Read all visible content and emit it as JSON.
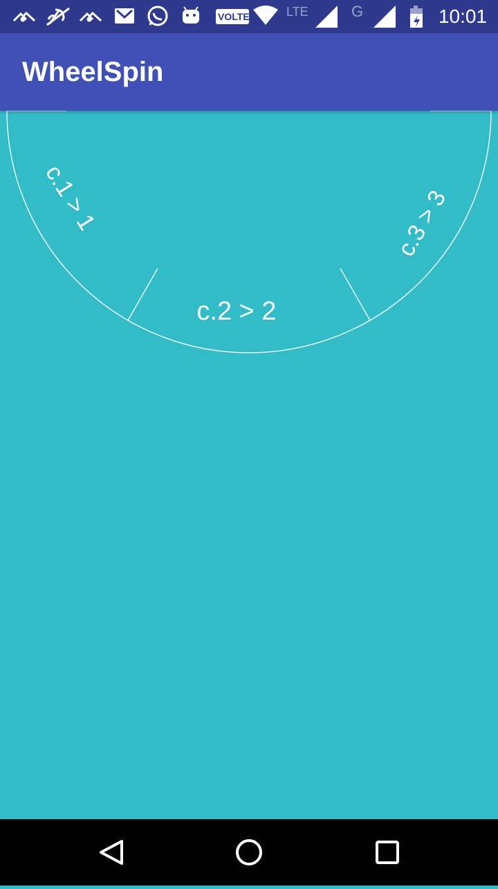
{
  "status_bar": {
    "time": "10:01",
    "network_label_volte": "VOLTE",
    "network_label_lte": "LTE",
    "network_label_g": "G",
    "icons": [
      "mountain-icon",
      "no-location-icon",
      "mountain-icon",
      "gmail-icon",
      "whatsapp-icon",
      "android-icon",
      "volte-icon",
      "wifi-icon",
      "lte-signal-icon",
      "g-signal-icon",
      "battery-charging-icon"
    ]
  },
  "app_bar": {
    "title": "WheelSpin"
  },
  "wheel": {
    "segments": [
      {
        "label": "c.1 > 1"
      },
      {
        "label": "c.2 > 2"
      },
      {
        "label": "c.3 > 3"
      }
    ],
    "line_color": "#e6f4f6",
    "text_color": "#ffffff"
  },
  "nav_bar": {
    "buttons": [
      "back-icon",
      "home-icon",
      "recents-icon"
    ]
  },
  "colors": {
    "status_bar": "#2f3a8f",
    "app_bar": "#3f51b5",
    "background": "#32bcc8",
    "nav_bar": "#000000"
  }
}
